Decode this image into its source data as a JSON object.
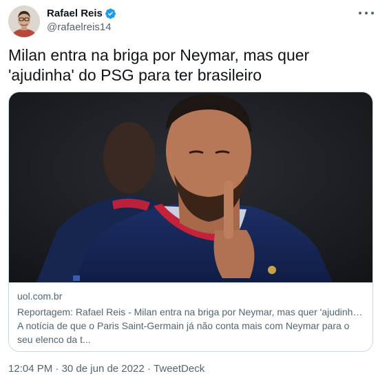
{
  "author": {
    "display_name": "Rafael Reis",
    "handle": "@rafaelreis14",
    "verified_icon": "verified-badge-icon",
    "avatar_icon": "avatar"
  },
  "tweet": {
    "text": "Milan entra na briga por Neymar, mas quer 'ajudinha' do PSG para ter brasileiro"
  },
  "card": {
    "domain": "uol.com.br",
    "title": "Reportagem: Rafael Reis - Milan entra na briga por Neymar, mas quer 'ajudinha...",
    "description": "A notícia de que o Paris Saint-Germain já não conta mais com Neymar para o seu elenco da t..."
  },
  "meta": {
    "time": "12:04 PM",
    "separator": " · ",
    "date": "30 de jun de 2022",
    "source": "TweetDeck"
  },
  "colors": {
    "text_primary": "#0f1419",
    "text_secondary": "#536471",
    "border": "#cfd9de",
    "verified": "#1d9bf0"
  }
}
